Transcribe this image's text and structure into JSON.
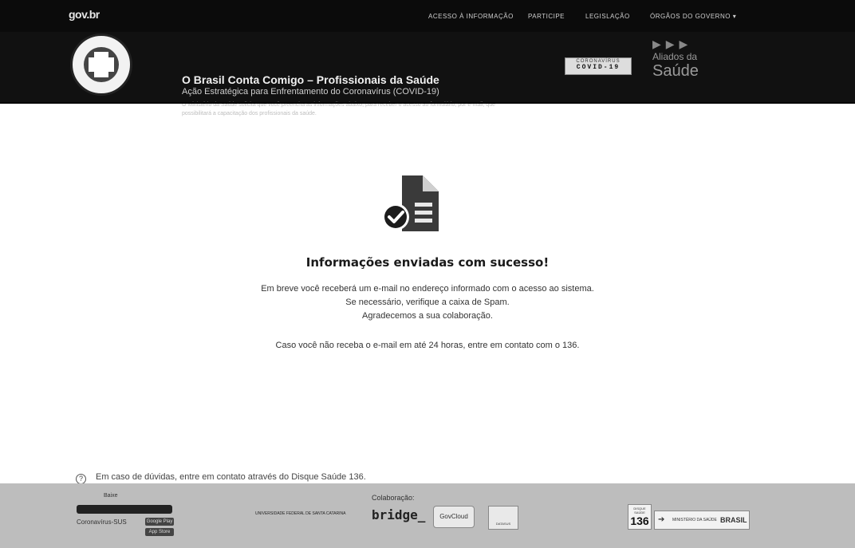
{
  "topbar": {
    "logo": "gov.br",
    "nav": [
      "ACESSO À INFORMAÇÃO",
      "PARTICIPE",
      "LEGISLAÇÃO",
      "ÓRGÃOS DO GOVERNO"
    ]
  },
  "header": {
    "title": "O Brasil Conta Comigo – Profissionais da Saúde",
    "subtitle": "Ação Estratégica para Enfrentamento do Coronavírus (COVID-19)",
    "description": "O Ministério da Saúde solicita que você preencha as informações abaixo, para receber o acesso ao formulário, por e-mail, que possibilitará a capacitação dos profissionais da saúde.",
    "covid_badge_line1": "CORONAVÍRUS",
    "covid_badge_line2": "COVID-19",
    "aliados_line1": "Aliados da",
    "aliados_line2": "Saúde"
  },
  "message": {
    "title": "Informações enviadas com sucesso!",
    "line1": "Em breve você receberá um e-mail no endereço informado com o acesso ao sistema.",
    "line2": "Se necessário, verifique a caixa de Spam.",
    "line3": "Agradecemos a sua colaboração.",
    "line4": "Caso você não receba o e-mail em até 24 horas, entre em contato com o 136."
  },
  "help": {
    "text": "Em caso de dúvidas, entre em contato através do Disque Saúde 136."
  },
  "footer": {
    "app_label": "Baixe",
    "app_name": "Coronavírus-SUS",
    "store1": "Google Play",
    "store2": "App Store",
    "collab_label": "Colaboração:",
    "ufsc": "UNIVERSIDADE FEDERAL DE SANTA CATARINA",
    "bridge": "bridge_",
    "govcloud": "GovCloud",
    "datasus": "DATASUS",
    "disque": "DISQUE SAÚDE",
    "disque_num": "136",
    "ministerio": "MINISTÉRIO DA SAÚDE",
    "brasil": "BRASIL"
  },
  "colors": {
    "header_bg": "#111111",
    "footer_bg": "#bdbdbd",
    "icon_dark": "#2a2a2a"
  }
}
